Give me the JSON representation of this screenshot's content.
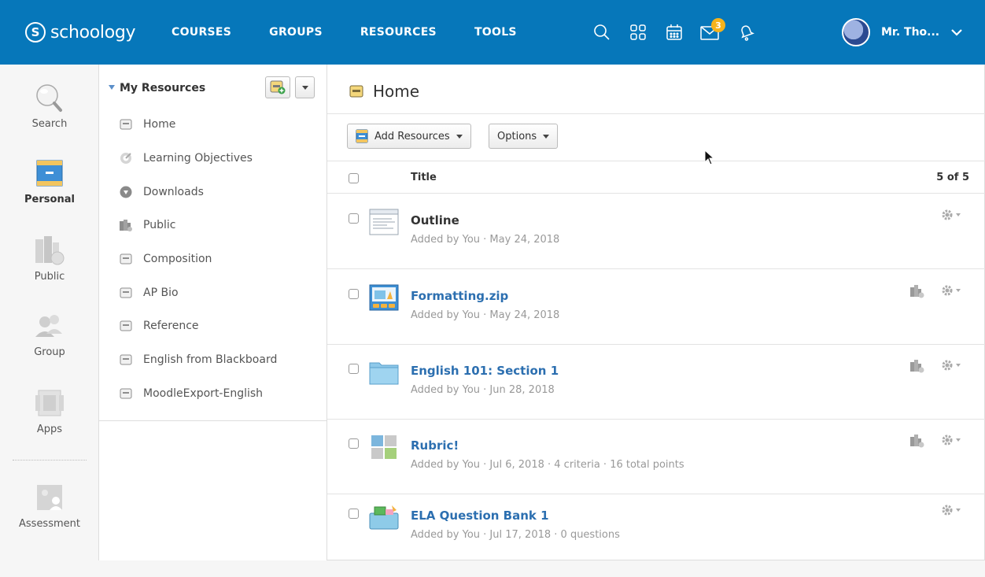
{
  "brand": {
    "name": "schoology",
    "mark": "S"
  },
  "nav": {
    "links": [
      "COURSES",
      "GROUPS",
      "RESOURCES",
      "TOOLS"
    ],
    "message_count": "3",
    "user_name": "Mr. Tho..."
  },
  "rail": {
    "items": [
      {
        "label": "Search",
        "icon": "magnifier-icon"
      },
      {
        "label": "Personal",
        "icon": "personal-box-icon",
        "active": true
      },
      {
        "label": "Public",
        "icon": "public-buildings-icon"
      },
      {
        "label": "Group",
        "icon": "group-people-icon"
      },
      {
        "label": "Apps",
        "icon": "apps-icon"
      },
      {
        "label": "Assessment",
        "icon": "assessment-icon"
      }
    ]
  },
  "tree": {
    "title": "My Resources",
    "items": [
      {
        "label": "Home",
        "icon": "box-icon"
      },
      {
        "label": "Learning Objectives",
        "icon": "objective-icon"
      },
      {
        "label": "Downloads",
        "icon": "download-icon"
      },
      {
        "label": "Public",
        "icon": "public-buildings-icon"
      },
      {
        "label": "Composition",
        "icon": "box-icon"
      },
      {
        "label": "AP Bio",
        "icon": "box-icon"
      },
      {
        "label": "Reference",
        "icon": "box-icon"
      },
      {
        "label": "English from Blackboard",
        "icon": "box-icon"
      },
      {
        "label": "MoodleExport-English",
        "icon": "box-icon"
      }
    ]
  },
  "main": {
    "title": "Home",
    "toolbar": {
      "add_label": "Add Resources",
      "options_label": "Options"
    },
    "table": {
      "col_title": "Title",
      "count": "5 of 5",
      "rows": [
        {
          "title": "Outline",
          "meta": "Added by You · May 24, 2018",
          "icon": "page-icon",
          "link": false,
          "public": false
        },
        {
          "title": "Formatting.zip",
          "meta": "Added by You · May 24, 2018",
          "icon": "package-icon",
          "link": true,
          "public": true
        },
        {
          "title": "English 101: Section 1",
          "meta": "Added by You · Jun 28, 2018",
          "icon": "folder-icon",
          "link": true,
          "public": true
        },
        {
          "title": "Rubric!",
          "meta": "Added by You · Jul 6, 2018 · 4 criteria  · 16 total points",
          "icon": "rubric-icon",
          "link": true,
          "public": true
        },
        {
          "title": "ELA Question Bank 1",
          "meta": "Added by You · Jul 17, 2018 · 0 questions",
          "icon": "question-bank-icon",
          "link": true,
          "public": false
        }
      ]
    }
  },
  "colors": {
    "nav_bg": "#0677ba",
    "link": "#2c6fb0",
    "badge": "#f6b31b"
  }
}
